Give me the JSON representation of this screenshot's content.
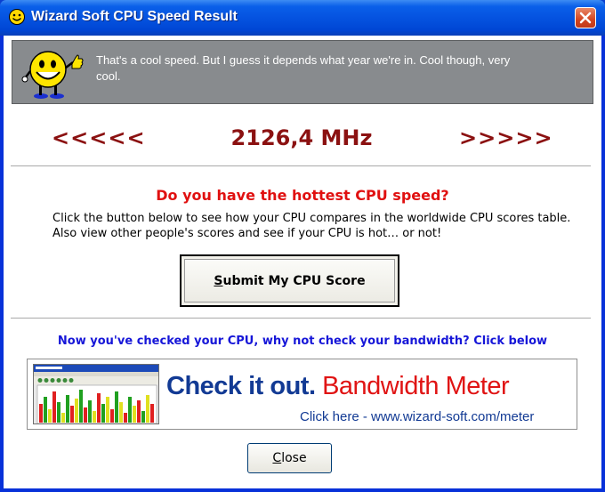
{
  "window": {
    "title": "Wizard Soft CPU Speed Result",
    "accent_color": "#0a5fe9",
    "close_icon": "close-icon"
  },
  "banner": {
    "message": "That's a cool speed.  But I guess it depends what year we're in.  Cool though, very cool.",
    "icon": "smiley-thumbs-up-icon"
  },
  "speed": {
    "left_arrows": "<<<<<",
    "value": "2126,4 MHz",
    "right_arrows": ">>>>>",
    "color": "#8b1111"
  },
  "compare": {
    "heading": "Do you have the hottest CPU speed?",
    "line1": "Click the button below to see how your CPU compares in the worldwide CPU scores table.",
    "line2": "Also view other people's scores and see if your CPU is hot… or not!",
    "submit_label_accel": "S",
    "submit_label_rest": "ubmit My CPU Score"
  },
  "bandwidth": {
    "heading": "Now you've checked your CPU, why not check your bandwidth? Click below",
    "ad_check": "Check it out.",
    "ad_product": "Bandwidth Meter",
    "ad_link": "Click here - www.wizard-soft.com/meter"
  },
  "footer": {
    "close_accel": "C",
    "close_rest": "lose"
  }
}
